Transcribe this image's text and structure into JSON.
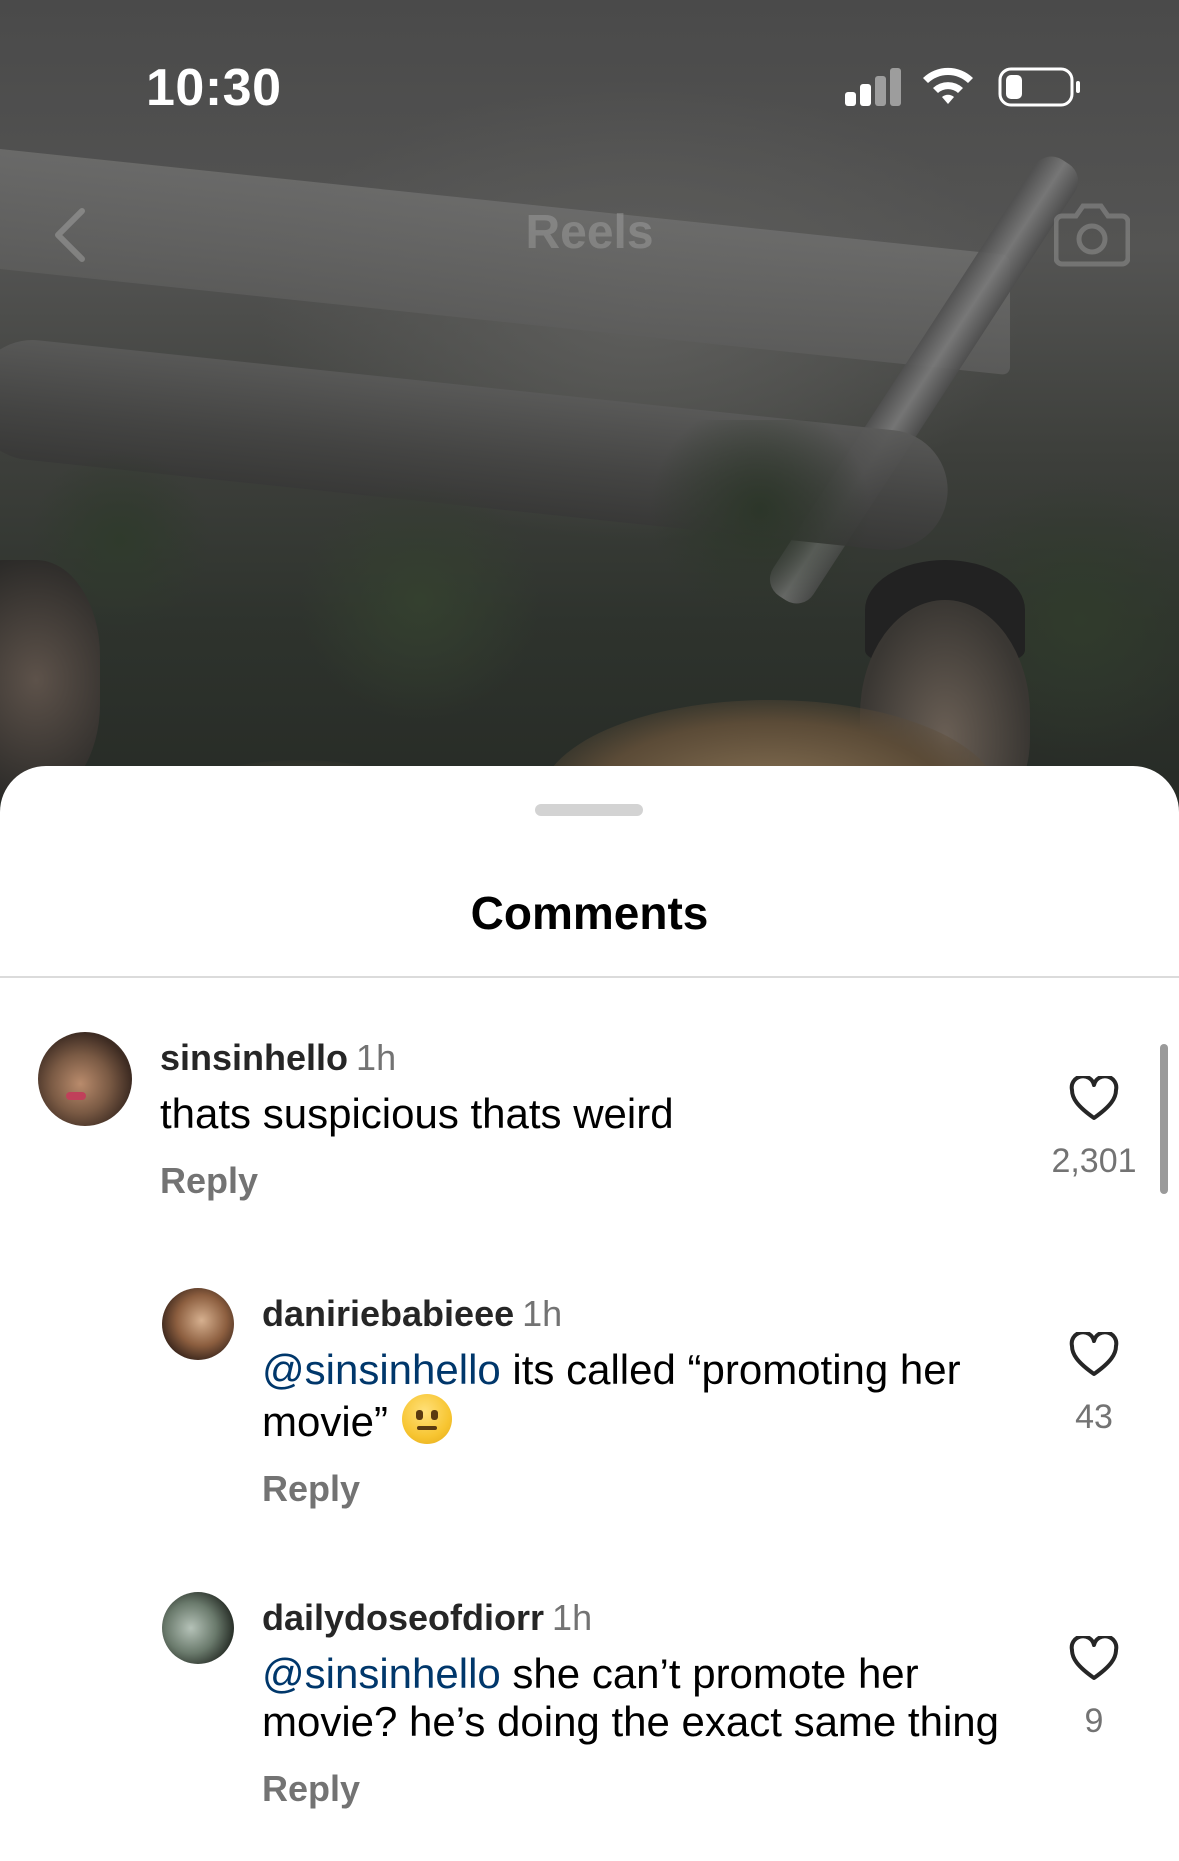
{
  "status_bar": {
    "time": "10:30"
  },
  "header": {
    "title": "Reels",
    "back_icon": "chevron-left-icon",
    "camera_icon": "camera-icon"
  },
  "sheet": {
    "title": "Comments",
    "comments": [
      {
        "username": "sinsinhello",
        "time": "1h",
        "mention": "",
        "text": "thats suspicious thats weird",
        "reply_label": "Reply",
        "likes": "2,301"
      },
      {
        "username": "daniriebabieee",
        "time": "1h",
        "mention": "@sinsinhello",
        "text": " its called “promoting her movie”",
        "emoji": "neutral-face",
        "reply_label": "Reply",
        "likes": "43"
      },
      {
        "username": "dailydoseofdiorr",
        "time": "1h",
        "mention": "@sinsinhello",
        "text": " she can’t promote her movie? he’s doing the exact same thing",
        "reply_label": "Reply",
        "likes": "9"
      }
    ]
  },
  "colors": {
    "mention": "#00376b",
    "secondary_text": "#737373",
    "sheet_bg": "#ffffff"
  }
}
